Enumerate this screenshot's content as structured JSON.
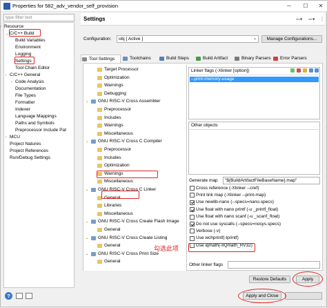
{
  "window": {
    "title": "Properties for 582_adv_vendor_self_provision",
    "minimize_glyph": "─",
    "maximize_glyph": "☐",
    "close_glyph": "✕"
  },
  "left": {
    "filter_placeholder": "type filter text",
    "items": [
      {
        "label": "Resource",
        "twisty": "›"
      },
      {
        "label": "C/C++ Build",
        "twisty": "⌄"
      },
      {
        "label": "Build Variables",
        "twisty": ""
      },
      {
        "label": "Environment",
        "twisty": ""
      },
      {
        "label": "Logging",
        "twisty": ""
      },
      {
        "label": "Settings",
        "twisty": ""
      },
      {
        "label": "Tool Chain Editor",
        "twisty": ""
      },
      {
        "label": "C/C++ General",
        "twisty": "›"
      },
      {
        "label": "Code Analysis",
        "twisty": "›"
      },
      {
        "label": "Documentation",
        "twisty": ""
      },
      {
        "label": "File Types",
        "twisty": ""
      },
      {
        "label": "Formatter",
        "twisty": ""
      },
      {
        "label": "Indexer",
        "twisty": ""
      },
      {
        "label": "Language Mappings",
        "twisty": ""
      },
      {
        "label": "Paths and Symbols",
        "twisty": ""
      },
      {
        "label": "Preprocessor Include Pat",
        "twisty": ""
      },
      {
        "label": "MCU",
        "twisty": "›"
      },
      {
        "label": "Project Natures",
        "twisty": ""
      },
      {
        "label": "Project References",
        "twisty": ""
      },
      {
        "label": "Run/Debug Settings",
        "twisty": ""
      }
    ]
  },
  "settings": {
    "heading": "Settings",
    "configuration_label": "Configuration:",
    "configuration_value": "obj  [ Active ]",
    "manage_button": "Manage Configurations..."
  },
  "tabs": [
    {
      "label": "Tool Settings",
      "color": "#8a8a8a"
    },
    {
      "label": "Toolchains",
      "color": "#6a8fbf"
    },
    {
      "label": "Build Steps",
      "color": "#5a7fae"
    },
    {
      "label": "Build Artifact",
      "color": "#4a9a4a"
    },
    {
      "label": "Binary Parsers",
      "color": "#7a7a7a"
    },
    {
      "label": "Error Parsers",
      "color": "#d04040"
    }
  ],
  "tool_tree": [
    {
      "label": "Target Processor",
      "twisty": "",
      "level": 1
    },
    {
      "label": "Optimization",
      "twisty": "",
      "level": 1
    },
    {
      "label": "Warnings",
      "twisty": "",
      "level": 1
    },
    {
      "label": "Debugging",
      "twisty": "",
      "level": 1
    },
    {
      "label": "GNU RISC-V Cross Assembler",
      "twisty": "⌄",
      "level": 0
    },
    {
      "label": "Preprocessor",
      "twisty": "",
      "level": 1
    },
    {
      "label": "Includes",
      "twisty": "",
      "level": 1
    },
    {
      "label": "Warnings",
      "twisty": "",
      "level": 1
    },
    {
      "label": "Miscellaneous",
      "twisty": "",
      "level": 1
    },
    {
      "label": "GNU RISC-V Cross C Compiler",
      "twisty": "⌄",
      "level": 0
    },
    {
      "label": "Preprocessor",
      "twisty": "",
      "level": 1
    },
    {
      "label": "Includes",
      "twisty": "",
      "level": 1
    },
    {
      "label": "Optimization",
      "twisty": "",
      "level": 1
    },
    {
      "label": "Warnings",
      "twisty": "",
      "level": 1
    },
    {
      "label": "Miscellaneous",
      "twisty": "",
      "level": 1
    },
    {
      "label": "GNU RISC-V Cross C Linker",
      "twisty": "⌄",
      "level": 0
    },
    {
      "label": "General",
      "twisty": "",
      "level": 1
    },
    {
      "label": "Libraries",
      "twisty": "",
      "level": 1
    },
    {
      "label": "Miscellaneous",
      "twisty": "",
      "level": 1
    },
    {
      "label": "GNU RISC-V Cross Create Flash Image",
      "twisty": "⌄",
      "level": 0
    },
    {
      "label": "General",
      "twisty": "",
      "level": 1
    },
    {
      "label": "GNU RISC-V Cross Create Listing",
      "twisty": "⌄",
      "level": 0
    },
    {
      "label": "General",
      "twisty": "",
      "level": 1
    },
    {
      "label": "GNU RISC-V Cross Print Size",
      "twisty": "⌄",
      "level": 0
    },
    {
      "label": "General",
      "twisty": "",
      "level": 1
    }
  ],
  "linker": {
    "flags_header": "Linker flags (-Xlinker [option])",
    "flags_items": [
      "--print-memory-usage"
    ],
    "other_objects_header": "Other objects",
    "generate_map_label": "Generate map",
    "generate_map_value": "\"${BuildArtifactFileBaseName}.map\"",
    "checkboxes": [
      {
        "label": "Cross reference (-Xlinker --cref)",
        "checked": false
      },
      {
        "label": "Print link map (-Xlinker --print-map)",
        "checked": false
      },
      {
        "label": "Use newlib-nano (--specs=nano.specs)",
        "checked": true
      },
      {
        "label": "Use float with nano printf (-u _printf_float)",
        "checked": true
      },
      {
        "label": "Use float with nano scanf (-u _scanf_float)",
        "checked": false
      },
      {
        "label": "Do not use syscalls (--specs=nosys.specs)",
        "checked": true
      },
      {
        "label": "Verbose (-v)",
        "checked": false
      },
      {
        "label": "Use wchprintf(-lprintf)",
        "checked": false
      },
      {
        "label": "Use iqmath(-lIQmath_RV32)",
        "checked": false
      }
    ],
    "other_flags_label": "Other linker flags"
  },
  "annotation_text": "勾选此项",
  "buttons": {
    "restore_defaults": "Restore Defaults",
    "apply": "Apply",
    "apply_and_close": "Apply and Close",
    "help_glyph": "?"
  }
}
